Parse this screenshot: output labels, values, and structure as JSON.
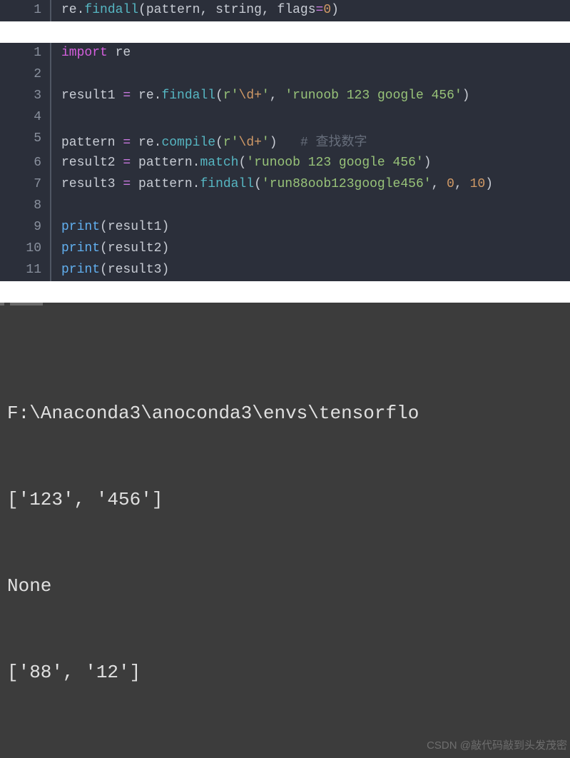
{
  "block1": {
    "line1": {
      "num": "1",
      "t_re": "re",
      "t_dot1": ".",
      "t_findall": "findall",
      "t_open": "(",
      "t_pattern": "pattern",
      "t_c1": ", ",
      "t_string": "string",
      "t_c2": ", ",
      "t_flags": "flags",
      "t_eq": "=",
      "t_zero": "0",
      "t_close": ")"
    }
  },
  "block2": {
    "l1": {
      "num": "1",
      "t_import": "import",
      "t_sp": " ",
      "t_re": "re"
    },
    "l2": {
      "num": "2"
    },
    "l3": {
      "num": "3",
      "t_res": "result1 ",
      "t_eq": "=",
      "t_sp": " re",
      "t_dot": ".",
      "t_fn": "findall",
      "t_open": "(",
      "t_r": "r",
      "t_q1": "'",
      "t_esc": "\\d+",
      "t_q2": "'",
      "t_c": ", ",
      "t_s2": "'runoob 123 google 456'",
      "t_close": ")"
    },
    "l4": {
      "num": "4"
    },
    "l5": {
      "num": "5",
      "t_pat": "pattern ",
      "t_eq": "=",
      "t_re": " re",
      "t_dot": ".",
      "t_fn": "compile",
      "t_open": "(",
      "t_r": "r",
      "t_q1": "'",
      "t_esc": "\\d+",
      "t_q2": "'",
      "t_close": ")",
      "t_pad": "   ",
      "t_cmt": "# 查找数字"
    },
    "l6": {
      "num": "6",
      "t_res": "result2 ",
      "t_eq": "=",
      "t_pat": " pattern",
      "t_dot": ".",
      "t_fn": "match",
      "t_open": "(",
      "t_s": "'runoob 123 google 456'",
      "t_close": ")"
    },
    "l7": {
      "num": "7",
      "t_res": "result3 ",
      "t_eq": "=",
      "t_pat": " pattern",
      "t_dot": ".",
      "t_fn": "findall",
      "t_open": "(",
      "t_s": "'run88oob123google456'",
      "t_c1": ", ",
      "t_n1": "0",
      "t_c2": ", ",
      "t_n2": "10",
      "t_close": ")"
    },
    "l8": {
      "num": "8"
    },
    "l9": {
      "num": "9",
      "t_print": "print",
      "t_open": "(",
      "t_arg": "result1",
      "t_close": ")"
    },
    "l10": {
      "num": "10",
      "t_print": "print",
      "t_open": "(",
      "t_arg": "result2",
      "t_close": ")"
    },
    "l11": {
      "num": "11",
      "t_print": "print",
      "t_open": "(",
      "t_arg": "result3",
      "t_close": ")"
    }
  },
  "terminal": {
    "l1": "F:\\Anaconda3\\anoconda3\\envs\\tensorflo",
    "l2": "['123', '456']",
    "l3": "None",
    "l4": "['88', '12']"
  },
  "watermark": "CSDN @敲代码敲到头发茂密"
}
